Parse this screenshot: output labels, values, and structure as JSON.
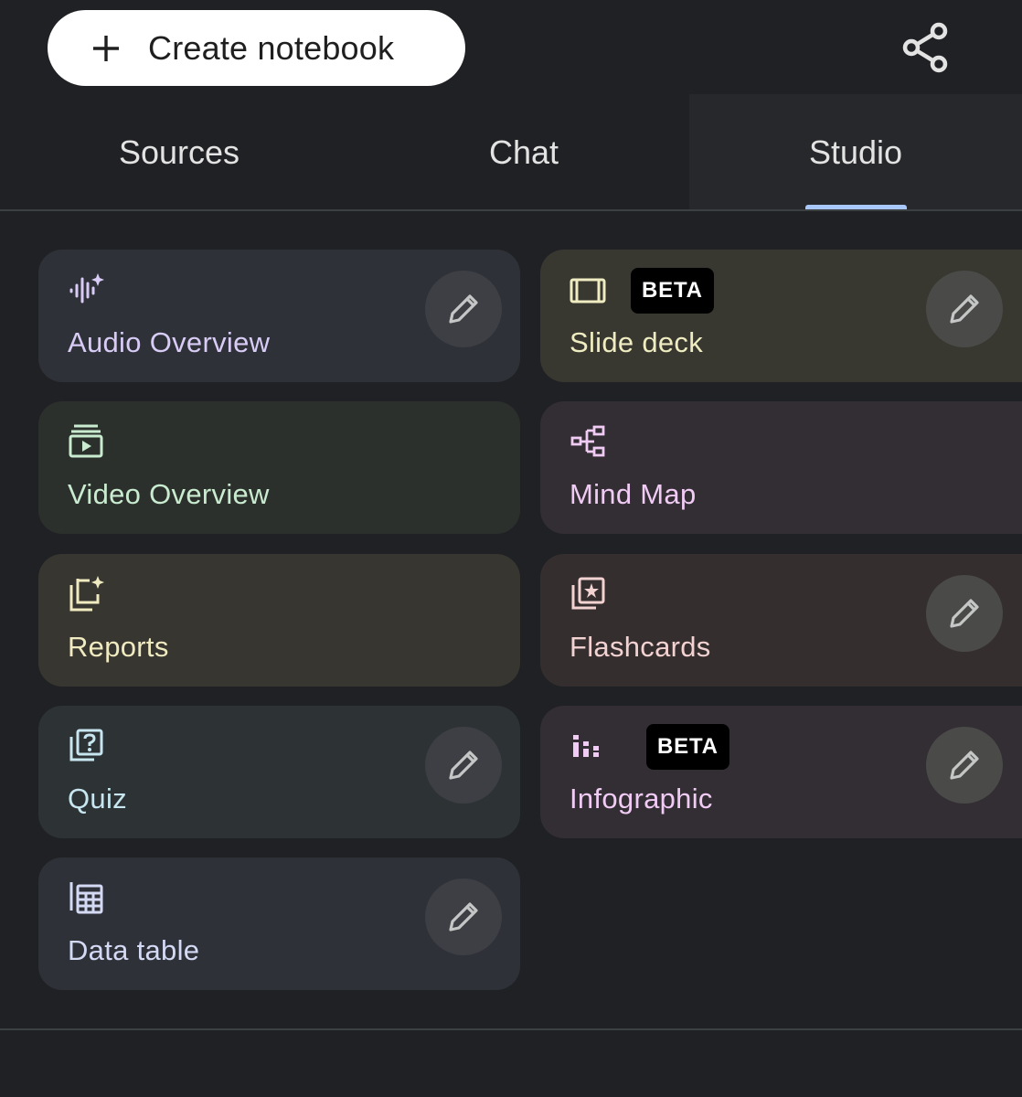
{
  "header": {
    "create_label": "Create notebook",
    "create_icon": "plus-icon",
    "share_icon": "share-icon"
  },
  "tabs": [
    {
      "label": "Sources",
      "active": false
    },
    {
      "label": "Chat",
      "active": false
    },
    {
      "label": "Studio",
      "active": true
    }
  ],
  "colors": {
    "background": "#202124",
    "active_tab_indicator": "#a8c7fa"
  },
  "cards": [
    {
      "label": "Audio Overview",
      "icon": "audio-waveform-sparkle-icon",
      "editable": true,
      "badge": "",
      "bg": "#2f3138",
      "fg": "#d8ccf6"
    },
    {
      "label": "Slide deck",
      "icon": "slides-icon",
      "editable": true,
      "badge": "BETA",
      "bg": "#383830",
      "fg": "#eeecc0"
    },
    {
      "label": "Video Overview",
      "icon": "video-play-icon",
      "editable": false,
      "badge": "",
      "bg": "#2c302c",
      "fg": "#c9ebd0"
    },
    {
      "label": "Mind Map",
      "icon": "mind-map-icon",
      "editable": false,
      "badge": "",
      "bg": "#332d34",
      "fg": "#f0ccf4"
    },
    {
      "label": "Reports",
      "icon": "reports-sparkle-icon",
      "editable": false,
      "badge": "",
      "bg": "#373630",
      "fg": "#f0eac0"
    },
    {
      "label": "Flashcards",
      "icon": "flashcards-icon",
      "editable": true,
      "badge": "",
      "bg": "#352e2e",
      "fg": "#f3d2d2"
    },
    {
      "label": "Quiz",
      "icon": "quiz-icon",
      "editable": true,
      "badge": "",
      "bg": "#2d3235",
      "fg": "#c7e6f0"
    },
    {
      "label": "Infographic",
      "icon": "infographic-icon",
      "editable": true,
      "badge": "BETA",
      "bg": "#332d34",
      "fg": "#f0ccf4"
    },
    {
      "label": "Data table",
      "icon": "data-table-icon",
      "editable": true,
      "badge": "",
      "bg": "#2f3138",
      "fg": "#d4d9f4"
    }
  ]
}
